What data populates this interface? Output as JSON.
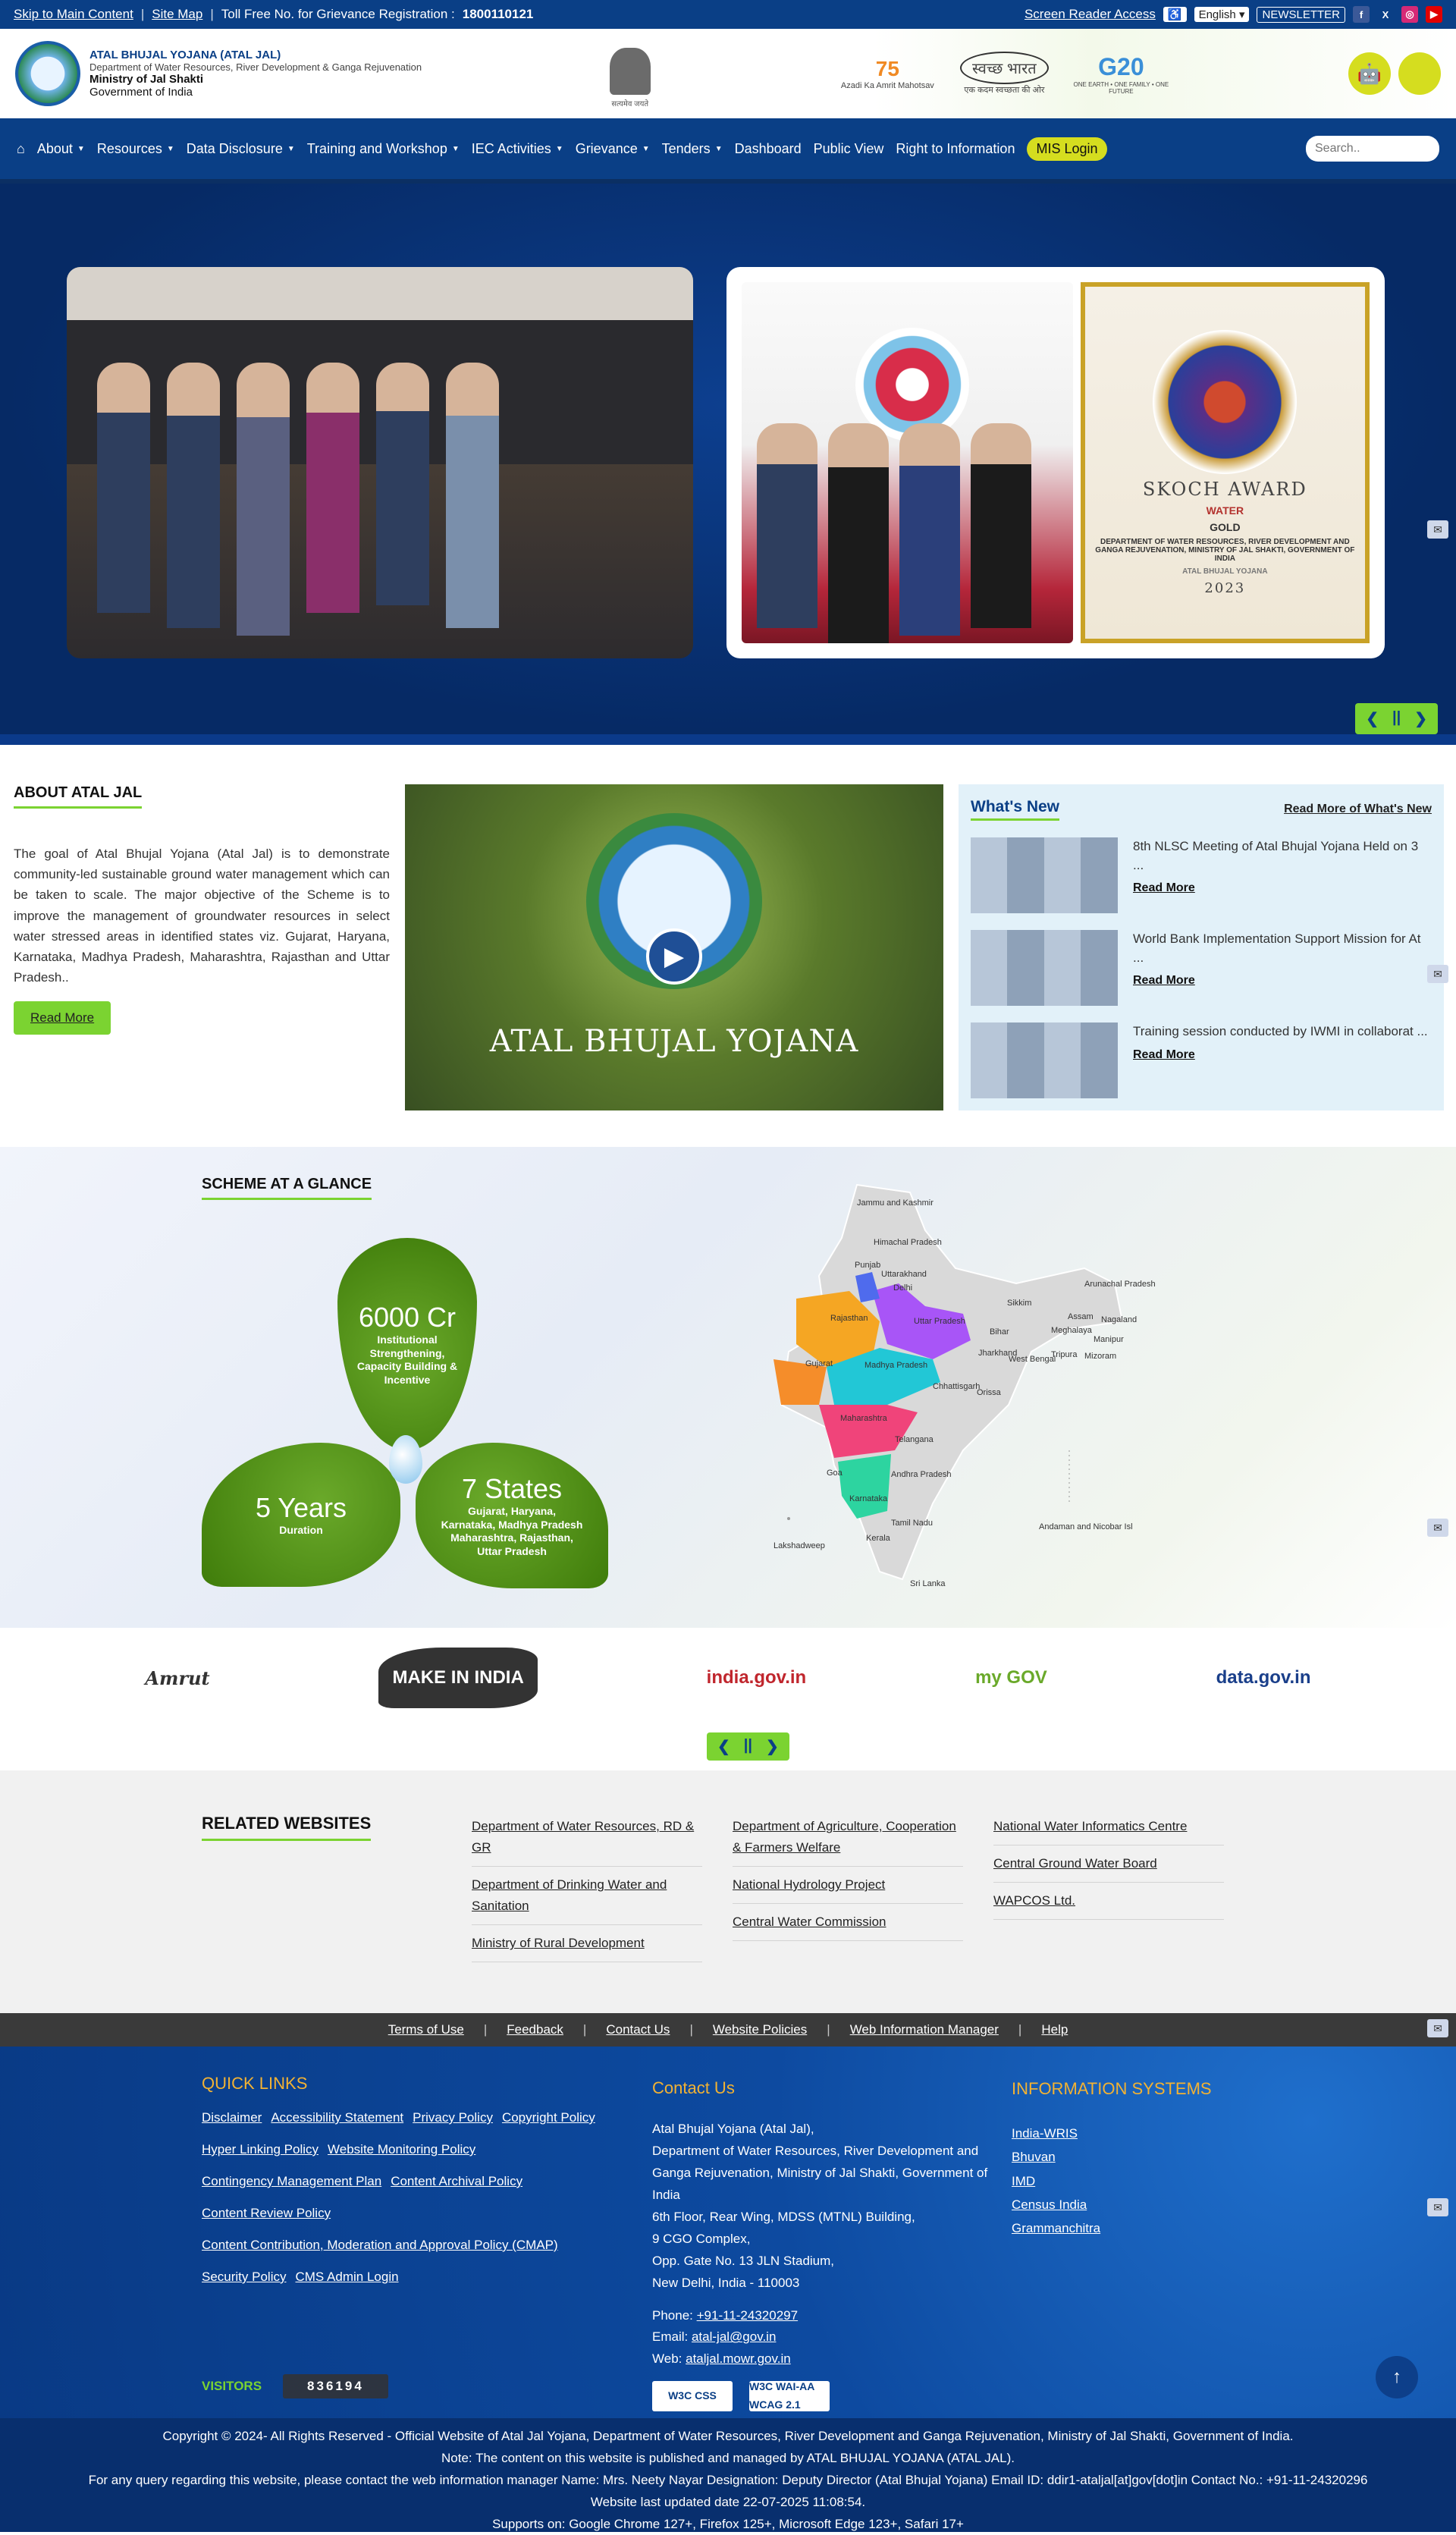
{
  "topbar": {
    "skip": "Skip to Main Content",
    "sitemap": "Site Map",
    "tollfree_label": "Toll Free No. for Grievance Registration :",
    "tollfree_number": "1800110121",
    "screen_reader": "Screen Reader Access",
    "language": "English",
    "newsletter": "NEWSLETTER",
    "social_icons": [
      "facebook-icon",
      "x-icon",
      "instagram-icon",
      "youtube-icon"
    ]
  },
  "header": {
    "title": "ATAL BHUJAL YOJANA (ATAL JAL)",
    "dept": "Department of Water Resources, River Development & Ganga Rejuvenation",
    "ministry": "Ministry of Jal Shakti",
    "govt": "Government of India",
    "emblem_caption": "सत्यमेव जयते",
    "partner1": "Azadi Ka Amrit Mahotsav",
    "partner2": "स्वच्छ भारत",
    "partner2_caption": "एक कदम स्वच्छता की ओर",
    "partner3": "G20",
    "partner3_caption": "ONE EARTH • ONE FAMILY • ONE FUTURE",
    "apps": [
      "android-icon",
      "apple-icon"
    ]
  },
  "nav": {
    "items": [
      {
        "label": "About",
        "caret": true
      },
      {
        "label": "Resources",
        "caret": true
      },
      {
        "label": "Data Disclosure",
        "caret": true
      },
      {
        "label": "Training and Workshop",
        "caret": true
      },
      {
        "label": "IEC Activities",
        "caret": true
      },
      {
        "label": "Grievance",
        "caret": true
      },
      {
        "label": "Tenders",
        "caret": true
      },
      {
        "label": "Dashboard",
        "caret": false
      },
      {
        "label": "Public View",
        "caret": false
      },
      {
        "label": "Right to Information",
        "caret": false
      }
    ],
    "mis": "MIS Login",
    "search_placeholder": "Search.."
  },
  "hero": {
    "award_title": "SKOCH AWARD",
    "award_sub1": "WATER",
    "award_sub2": "GOLD",
    "award_desc": "DEPARTMENT OF WATER RESOURCES, RIVER DEVELOPMENT AND GANGA REJUVENATION, MINISTRY OF JAL SHAKTI, GOVERNMENT OF INDIA",
    "award_org": "ATAL BHUJAL YOJANA",
    "award_year": "2023",
    "ctrl_prev": "❮",
    "ctrl_pause": "||",
    "ctrl_next": "❯"
  },
  "about": {
    "title": "ABOUT ATAL JAL",
    "text": "The goal of Atal Bhujal Yojana (Atal Jal) is to demonstrate community-led sustainable ground water management which can be taken to scale. The major objective of the Scheme is to improve the management of groundwater resources in select water stressed areas in identified states viz. Gujarat, Haryana, Karnataka, Madhya Pradesh, Maharashtra, Rajasthan and Uttar Pradesh..",
    "button": "Read More"
  },
  "video": {
    "title": "ATAL BHUJAL YOJANA"
  },
  "whatsnew": {
    "title": "What's New",
    "more": "Read More of What's New",
    "items": [
      {
        "text": "8th NLSC Meeting of Atal Bhujal Yojana Held on 3 ...",
        "link": "Read More"
      },
      {
        "text": "World Bank Implementation Support Mission for At ...",
        "link": "Read More"
      },
      {
        "text": "Training session conducted by IWMI in collaborat ...",
        "link": "Read More"
      }
    ]
  },
  "glance": {
    "title": "SCHEME AT A GLANCE",
    "top_value": "6000 Cr",
    "top_label": "Institutional Strengthening, Capacity Building  & Incentive",
    "left_value": "5 Years",
    "left_label": "Duration",
    "right_value": "7 States",
    "right_label": "Gujarat, Haryana, Karnataka, Madhya Pradesh Maharashtra, Rajasthan, Uttar Pradesh",
    "map_labels": [
      "Jammu and Kashmir",
      "Himachal Pradesh",
      "Punjab",
      "Uttarakhand",
      "Delhi",
      "Rajasthan",
      "Uttar Pradesh",
      "Bihar",
      "Sikkim",
      "Arunachal Pradesh",
      "Assam",
      "Nagaland",
      "Meghalaya",
      "Manipur",
      "Tripura",
      "Mizoram",
      "Gujarat",
      "Madhya Pradesh",
      "Jharkhand",
      "West Bengal",
      "Chhattisgarh",
      "Orissa",
      "Maharashtra",
      "Telangana",
      "Goa",
      "Andhra Pradesh",
      "Karnataka",
      "Tamil Nadu",
      "Kerala",
      "Lakshadweep",
      "Andaman and Nicobar Isl",
      "Sri Lanka"
    ],
    "highlight_colors": {
      "Rajasthan": "#f5a623",
      "Uttar Pradesh": "#a855f7",
      "Gujarat": "#f58d2a",
      "Madhya Pradesh": "#22c7d6",
      "Maharashtra": "#f0447a",
      "Karnataka": "#2dd4a0",
      "Haryana": "#4f6bed"
    }
  },
  "partner_logos": [
    "Amrut",
    "MAKE IN INDIA",
    "india.gov.in",
    "my GOV",
    "data.gov.in"
  ],
  "partner_ctrl": {
    "prev": "❮",
    "pause": "||",
    "next": "❯"
  },
  "related": {
    "title": "RELATED WEBSITES",
    "cols": [
      [
        "Department of Water Resources, RD & GR",
        "Department of Drinking Water and Sanitation",
        "Ministry of Rural Development"
      ],
      [
        "Department of Agriculture, Cooperation & Farmers Welfare",
        "National Hydrology Project",
        "Central Water Commission"
      ],
      [
        "National Water Informatics Centre",
        "Central Ground Water Board",
        "WAPCOS Ltd."
      ]
    ]
  },
  "footer_links": [
    "Terms of Use",
    "Feedback",
    "Contact Us",
    "Website Policies",
    "Web Information Manager",
    "Help"
  ],
  "quick_links": {
    "title": "QUICK LINKS",
    "rows": [
      [
        "Disclaimer",
        "Accessibility Statement",
        "Privacy Policy",
        "Copyright Policy"
      ],
      [
        "Hyper Linking Policy",
        "Website Monitoring Policy"
      ],
      [
        "Contingency Management Plan",
        "Content Archival Policy"
      ],
      [
        "Content Review Policy"
      ],
      [
        "Content Contribution, Moderation and Approval Policy (CMAP)"
      ],
      [
        "Security Policy",
        "CMS Admin Login"
      ]
    ]
  },
  "contact": {
    "title": "Contact Us",
    "lines": [
      "Atal Bhujal Yojana (Atal Jal),",
      "Department of Water Resources, River Development and Ganga Rejuvenation, Ministry of Jal Shakti, Government of India",
      "6th Floor, Rear Wing, MDSS (MTNL) Building,",
      "9 CGO Complex,",
      "Opp. Gate No. 13 JLN Stadium,",
      "New Delhi, India - 110003"
    ],
    "phone_label": "Phone:",
    "phone": "+91-11-24320297",
    "email_label": "Email:",
    "email": "atal-jal@gov.in",
    "web_label": "Web:",
    "web": "ataljal.mowr.gov.in"
  },
  "info_systems": {
    "title": "INFORMATION SYSTEMS",
    "items": [
      "India-WRIS",
      "Bhuvan",
      "IMD",
      "Census India",
      "Grammanchitra"
    ]
  },
  "visitors": {
    "label": "VISITORS",
    "count": "836194"
  },
  "badges": [
    "W3C CSS",
    "W3C WAI-AA WCAG 2.1"
  ],
  "bottom": {
    "line1": "Copyright © 2024- All Rights Reserved - Official Website of Atal Jal Yojana, Department of Water Resources, River Development and Ganga Rejuvenation, Ministry of Jal Shakti, Government of India.",
    "line2": "Note: The content on this website is published and managed by ATAL BHUJAL YOJANA (ATAL JAL).",
    "line3": "For any query regarding this website, please contact the web information manager Name: Mrs. Neety Nayar Designation: Deputy Director (Atal Bhujal Yojana) Email ID: ddir1-ataljal[at]gov[dot]in Contact No.: +91-11-24320296",
    "line4": "Website last updated date 22-07-2025 11:08:54.",
    "line5": "Supports on: Google Chrome 127+, Firefox 125+, Microsoft Edge 123+, Safari 17+"
  }
}
